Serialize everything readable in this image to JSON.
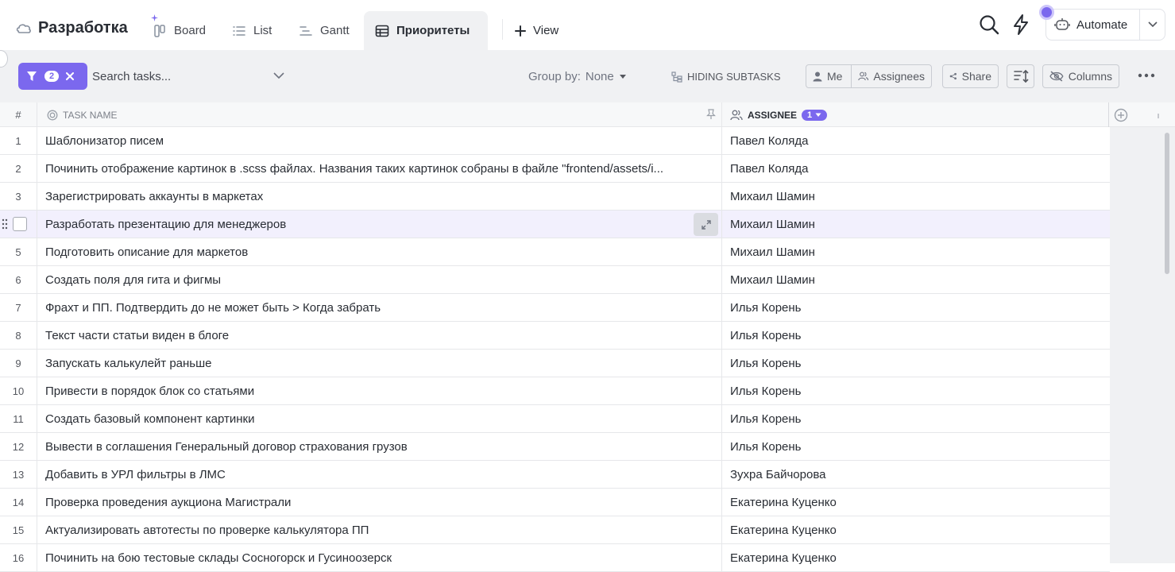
{
  "header": {
    "space_title": "Разработка",
    "tabs": [
      {
        "label": "Board",
        "icon": "board-icon"
      },
      {
        "label": "List",
        "icon": "list-icon"
      },
      {
        "label": "Gantt",
        "icon": "gantt-icon"
      },
      {
        "label": "Приоритеты",
        "icon": "table-icon",
        "active": true
      }
    ],
    "add_view_label": "View",
    "automate_label": "Automate"
  },
  "toolbar": {
    "filter_count": "2",
    "search_placeholder": "Search tasks...",
    "group_by_label": "Group by:",
    "group_by_value": "None",
    "hiding_subtasks_label": "HIDING SUBTASKS",
    "me_label": "Me",
    "assignees_label": "Assignees",
    "share_label": "Share",
    "columns_label": "Columns"
  },
  "table": {
    "col_num": "#",
    "col_task": "TASK NAME",
    "col_assignee": "ASSIGNEE",
    "assignee_badge": "1",
    "rows": [
      {
        "n": "1",
        "task": "Шаблонизатор писем",
        "assignee": "Павел Коляда"
      },
      {
        "n": "2",
        "task": "Починить отображение картинок в .scss файлах. Названия таких картинок собраны в файле \"frontend/assets/i...",
        "assignee": "Павел Коляда"
      },
      {
        "n": "3",
        "task": "Зарегистрировать аккаунты в маркетах",
        "assignee": "Михаил Шамин"
      },
      {
        "n": "4",
        "task": "Разработать презентацию для менеджеров",
        "assignee": "Михаил Шамин"
      },
      {
        "n": "5",
        "task": "Подготовить описание для маркетов",
        "assignee": "Михаил Шамин"
      },
      {
        "n": "6",
        "task": "Создать поля для гита и фигмы",
        "assignee": "Михаил Шамин"
      },
      {
        "n": "7",
        "task": "Фрахт и ПП. Подтвердить до не может быть > Когда забрать",
        "assignee": "Илья Корень"
      },
      {
        "n": "8",
        "task": "Текст части статьи виден в блоге",
        "assignee": "Илья Корень"
      },
      {
        "n": "9",
        "task": "Запускать калькулейт раньше",
        "assignee": "Илья Корень"
      },
      {
        "n": "10",
        "task": "Привести в порядок блок со статьями",
        "assignee": "Илья Корень"
      },
      {
        "n": "11",
        "task": "Создать базовый компонент картинки",
        "assignee": "Илья Корень"
      },
      {
        "n": "12",
        "task": "Вывести в соглашения Генеральный договор страхования грузов",
        "assignee": "Илья Корень"
      },
      {
        "n": "13",
        "task": "Добавить в УРЛ фильтры в ЛМС",
        "assignee": "Зухра Байчорова"
      },
      {
        "n": "14",
        "task": "Проверка проведения аукциона Магистрали",
        "assignee": "Екатерина Куценко"
      },
      {
        "n": "15",
        "task": "Актуализировать автотесты по проверке калькулятора ПП",
        "assignee": "Екатерина Куценко"
      },
      {
        "n": "16",
        "task": "Починить на бою тестовые склады Сосногорск и Гусиноозерск",
        "assignee": "Екатерина Куценко"
      }
    ]
  },
  "colors": {
    "accent": "#7b68ee",
    "toolbar_bg": "#f0f1f3",
    "hover_row": "#f2f0fd"
  }
}
